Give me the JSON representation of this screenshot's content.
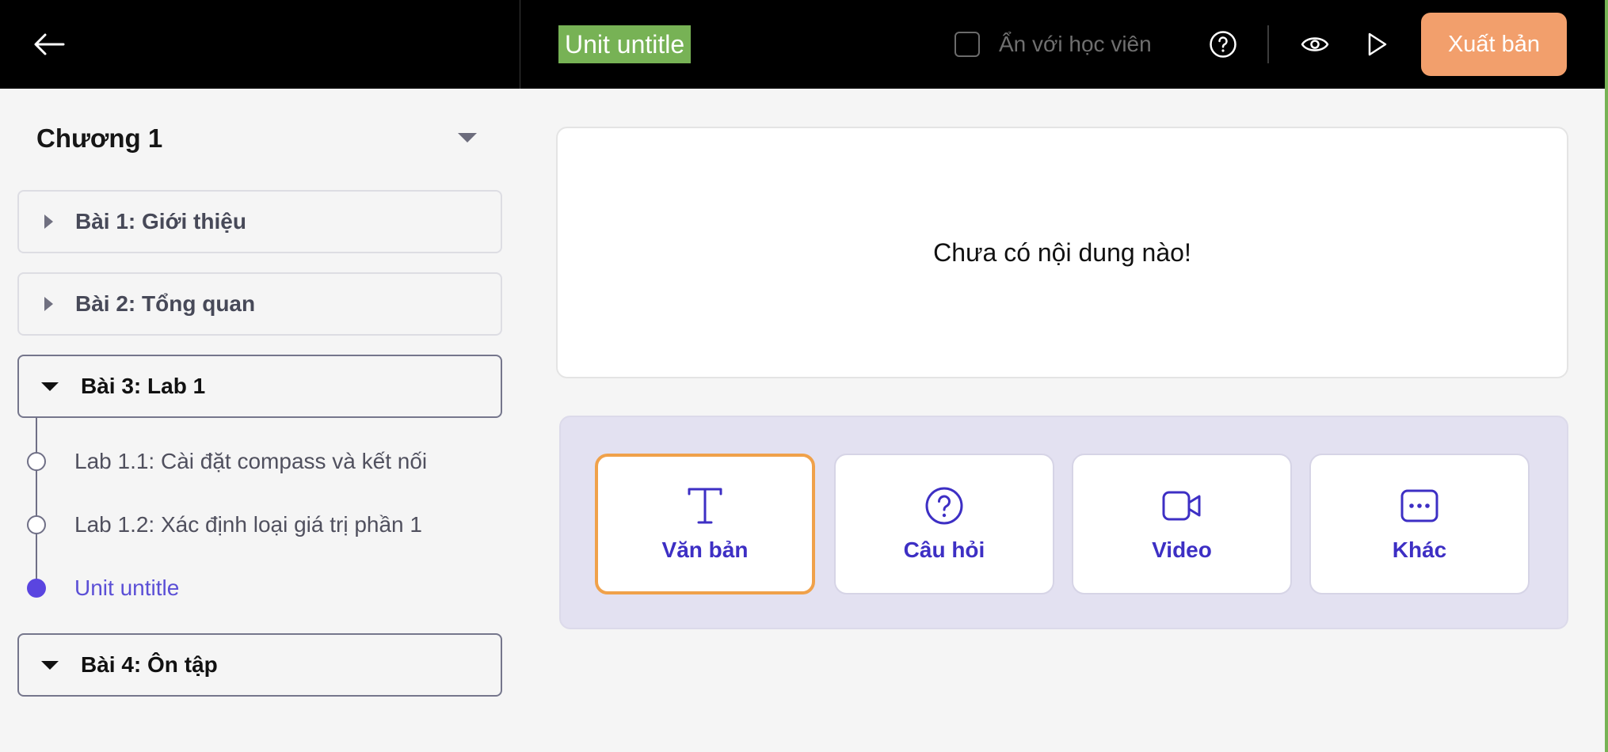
{
  "header": {
    "unit_title": "Unit untitle",
    "hide_label": "Ẩn với học viên",
    "publish_label": "Xuất bản"
  },
  "sidebar": {
    "chapter_title": "Chương 1",
    "lessons": [
      {
        "label": "Bài 1: Giới thiệu",
        "expanded": false
      },
      {
        "label": "Bài 2: Tổng quan",
        "expanded": false
      },
      {
        "label": "Bài 3: Lab 1",
        "expanded": true,
        "units": [
          {
            "label": "Lab 1.1: Cài đặt compass và kết nối",
            "active": false
          },
          {
            "label": "Lab 1.2: Xác định loại giá trị phần 1",
            "active": false
          },
          {
            "label": "Unit untitle",
            "active": true
          }
        ]
      },
      {
        "label": "Bài 4: Ôn tập",
        "expanded": true
      }
    ]
  },
  "content": {
    "empty_message": "Chưa có nội dung nào!",
    "tools": [
      {
        "label": "Văn bản",
        "icon": "text-icon",
        "selected": true
      },
      {
        "label": "Câu hỏi",
        "icon": "question-icon",
        "selected": false
      },
      {
        "label": "Video",
        "icon": "video-icon",
        "selected": false
      },
      {
        "label": "Khác",
        "icon": "more-icon",
        "selected": false
      }
    ]
  },
  "colors": {
    "accent": "#5a45e0",
    "publish": "#f29f6c",
    "title_highlight": "#77b255",
    "selected_border": "#f0a14a",
    "tool_text": "#3d2fc4"
  }
}
